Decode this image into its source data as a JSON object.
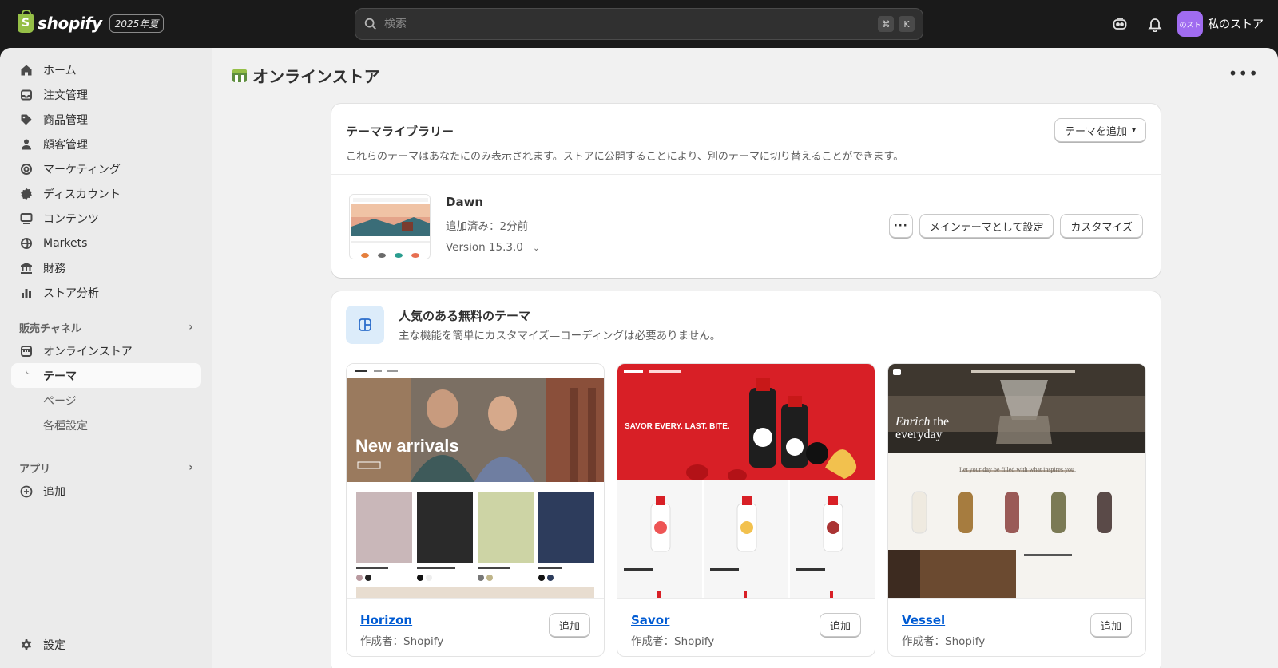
{
  "topbar": {
    "brand": "shopify",
    "edition": "2025年夏",
    "search_placeholder": "検索",
    "shortcut_keys": [
      "⌘",
      "K"
    ],
    "store_avatar_text": "のスト",
    "store_name": "私のストア"
  },
  "sidebar": {
    "items": [
      {
        "label": "ホーム",
        "icon": "home-icon"
      },
      {
        "label": "注文管理",
        "icon": "inbox-icon"
      },
      {
        "label": "商品管理",
        "icon": "tag-icon"
      },
      {
        "label": "顧客管理",
        "icon": "person-icon"
      },
      {
        "label": "マーケティング",
        "icon": "target-icon"
      },
      {
        "label": "ディスカウント",
        "icon": "discount-icon"
      },
      {
        "label": "コンテンツ",
        "icon": "content-icon"
      },
      {
        "label": "Markets",
        "icon": "globe-icon"
      },
      {
        "label": "財務",
        "icon": "bank-icon"
      },
      {
        "label": "ストア分析",
        "icon": "chart-icon"
      }
    ],
    "sales_channels_label": "販売チャネル",
    "online_store": "オンラインストア",
    "online_store_sub": [
      "テーマ",
      "ページ",
      "各種設定"
    ],
    "apps_label": "アプリ",
    "apps_add": "追加",
    "settings": "設定"
  },
  "page": {
    "title": "オンラインストア"
  },
  "library": {
    "title": "テーマライブラリー",
    "description": "これらのテーマはあなたにのみ表示されます。ストアに公開することにより、別のテーマに切り替えることができます。",
    "add_button": "テーマを追加",
    "theme": {
      "name": "Dawn",
      "added": "追加済み：2分前",
      "version": "Version 15.3.0",
      "set_main": "メインテーマとして設定",
      "customize": "カスタマイズ"
    }
  },
  "popular": {
    "title": "人気のある無料のテーマ",
    "description": "主な機能を簡単にカスタマイズ—コーディングは必要ありません。",
    "themes": [
      {
        "name": "Horizon",
        "author": "作成者：Shopify",
        "add": "追加",
        "hero_text": "New arrivals"
      },
      {
        "name": "Savor",
        "author": "作成者：Shopify",
        "add": "追加",
        "hero_text": "SAVOR EVERY. LAST. BITE."
      },
      {
        "name": "Vessel",
        "author": "作成者：Shopify",
        "add": "追加",
        "hero_text_1": "Enrich",
        "hero_text_2": "the",
        "hero_text_3": "everyday",
        "sub_text": "Let your day be filled with what inspires you."
      }
    ]
  },
  "colors": {
    "brand_green": "#95bf47",
    "link_blue": "#005bd3",
    "avatar_purple": "#a06cf0",
    "savor_red": "#d81f26"
  }
}
